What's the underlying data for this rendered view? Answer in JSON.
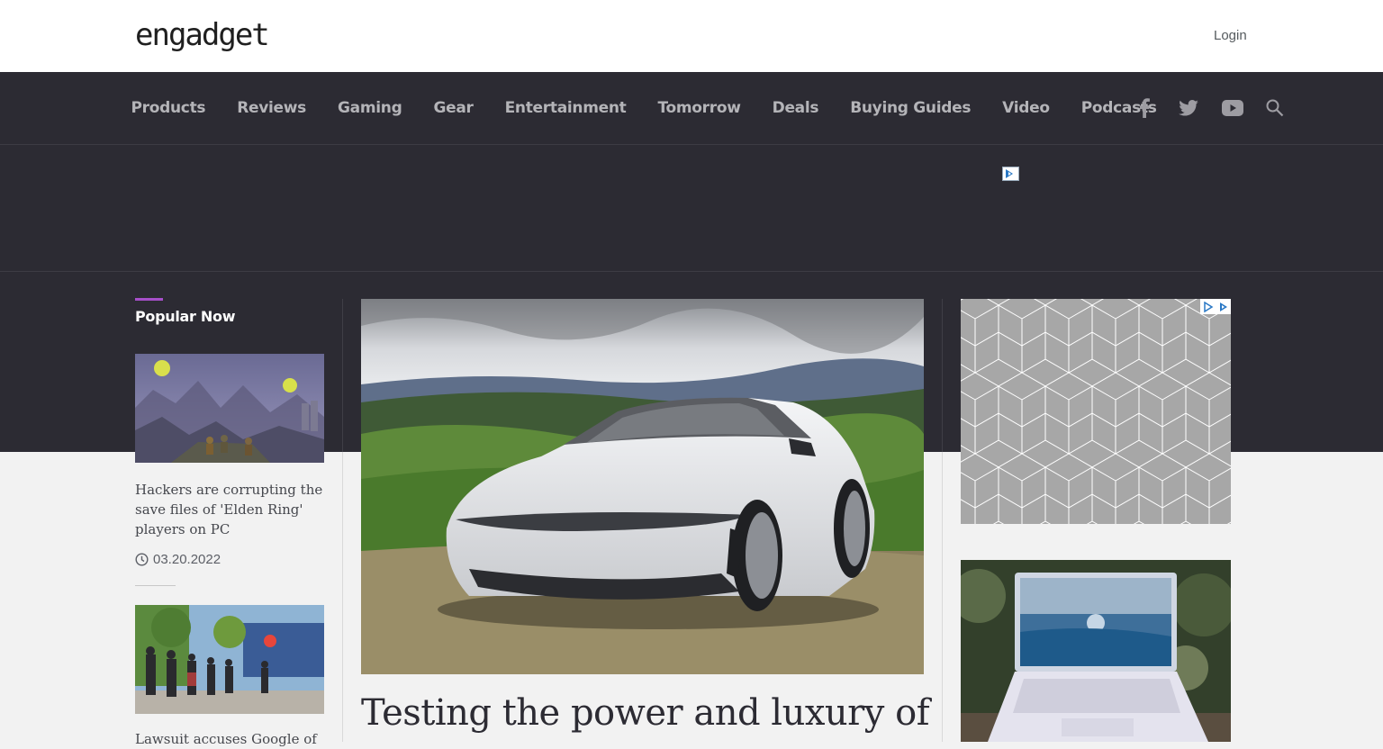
{
  "header": {
    "logo_text": "engadget",
    "login_label": "Login"
  },
  "nav": {
    "items": [
      {
        "label": "Products"
      },
      {
        "label": "Reviews"
      },
      {
        "label": "Gaming"
      },
      {
        "label": "Gear"
      },
      {
        "label": "Entertainment"
      },
      {
        "label": "Tomorrow"
      },
      {
        "label": "Deals"
      },
      {
        "label": "Buying Guides"
      },
      {
        "label": "Video"
      },
      {
        "label": "Podcasts"
      }
    ],
    "social_icons": [
      "facebook-icon",
      "twitter-icon",
      "youtube-icon",
      "search-icon"
    ]
  },
  "popular": {
    "title": "Popular Now",
    "stories": [
      {
        "title": "Hackers are corrupting the save files of 'Elden Ring' players on PC",
        "date": "03.20.2022"
      },
      {
        "title": "Lawsuit accuses Google of"
      }
    ]
  },
  "main": {
    "headline": "Testing the power and luxury of"
  },
  "colors": {
    "nav_bg": "#2c2b33",
    "accent": "#a64fc9",
    "page_bg": "#f2f2f2"
  }
}
